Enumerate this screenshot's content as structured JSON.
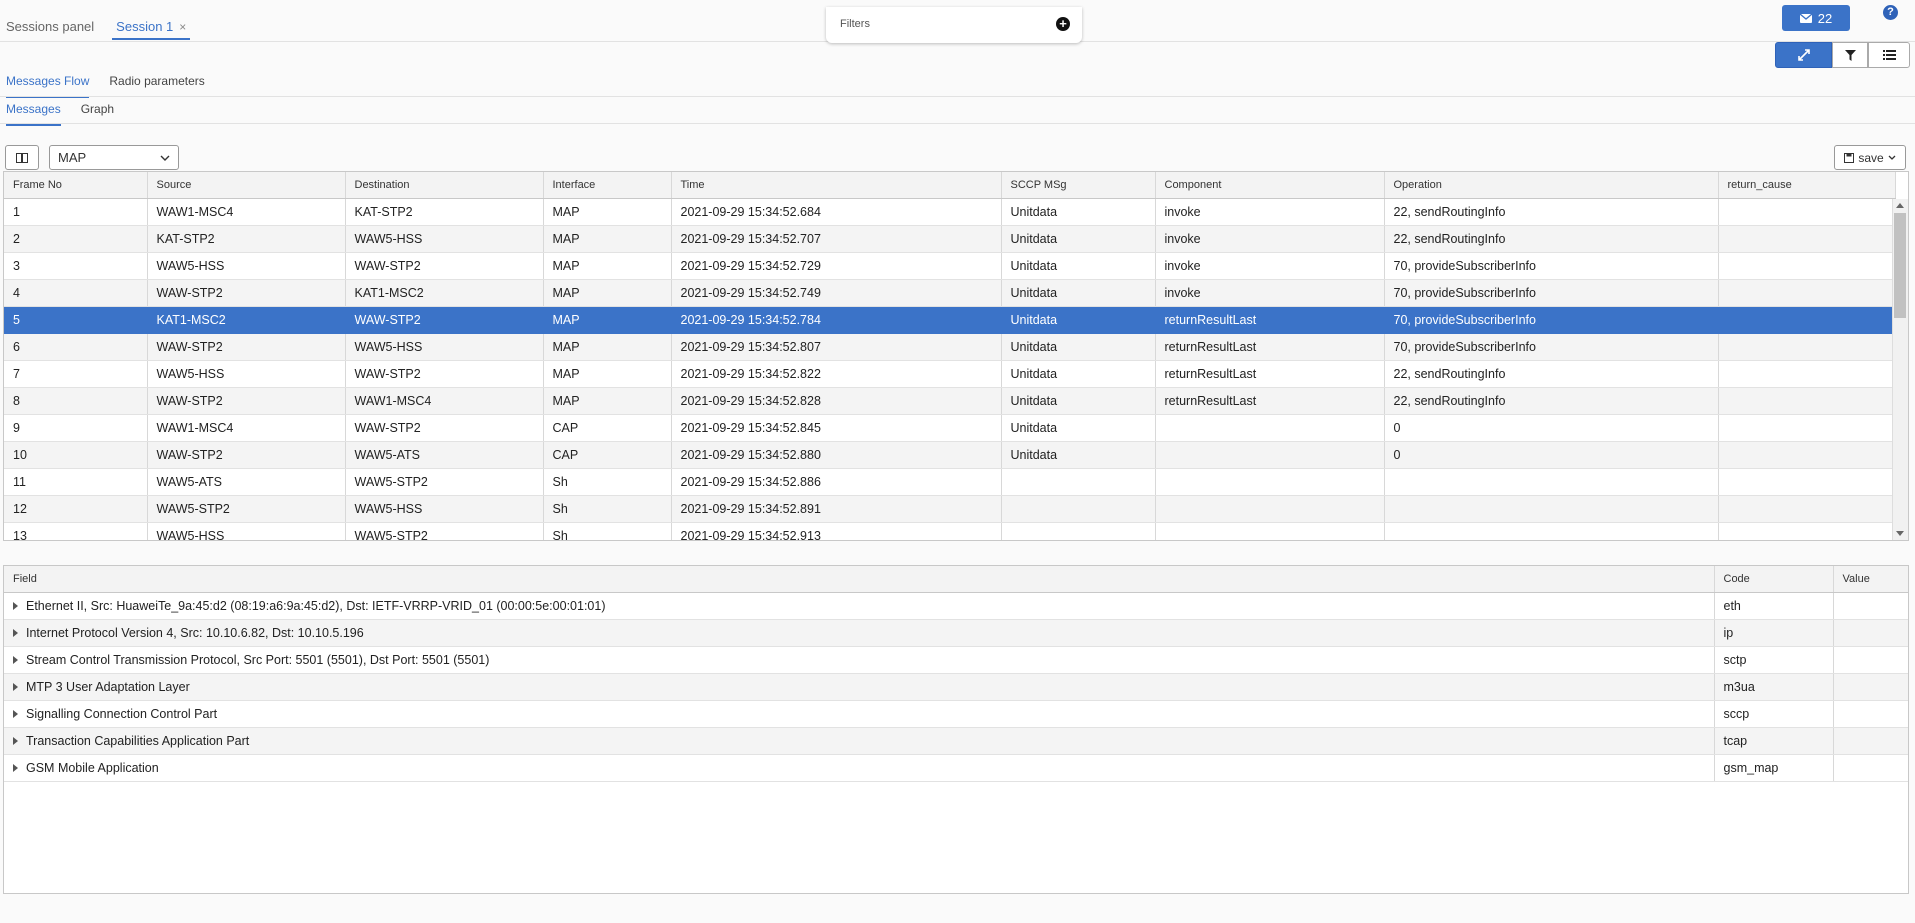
{
  "top_tabs": [
    {
      "label": "Sessions panel"
    },
    {
      "label": "Session 1",
      "close": "×"
    }
  ],
  "filters": {
    "label": "Filters",
    "add": "+"
  },
  "mail": {
    "count": "22"
  },
  "help": {
    "label": "?"
  },
  "tabs": {
    "level1": [
      {
        "label": "Messages Flow"
      },
      {
        "label": "Radio parameters"
      }
    ],
    "level2": [
      {
        "label": "Messages"
      },
      {
        "label": "Graph"
      }
    ]
  },
  "protocol_select": {
    "value": "MAP"
  },
  "save": {
    "label": "save"
  },
  "messages_table": {
    "columns": [
      "Frame No",
      "Source",
      "Destination",
      "Interface",
      "Time",
      "SCCP MSg",
      "Component",
      "Operation",
      "return_cause"
    ],
    "selected_index": 4,
    "rows": [
      [
        "1",
        "WAW1-MSC4",
        "KAT-STP2",
        "MAP",
        "2021-09-29 15:34:52.684",
        "Unitdata",
        "invoke",
        "22, sendRoutingInfo",
        ""
      ],
      [
        "2",
        "KAT-STP2",
        "WAW5-HSS",
        "MAP",
        "2021-09-29 15:34:52.707",
        "Unitdata",
        "invoke",
        "22, sendRoutingInfo",
        ""
      ],
      [
        "3",
        "WAW5-HSS",
        "WAW-STP2",
        "MAP",
        "2021-09-29 15:34:52.729",
        "Unitdata",
        "invoke",
        "70, provideSubscriberInfo",
        ""
      ],
      [
        "4",
        "WAW-STP2",
        "KAT1-MSC2",
        "MAP",
        "2021-09-29 15:34:52.749",
        "Unitdata",
        "invoke",
        "70, provideSubscriberInfo",
        ""
      ],
      [
        "5",
        "KAT1-MSC2",
        "WAW-STP2",
        "MAP",
        "2021-09-29 15:34:52.784",
        "Unitdata",
        "returnResultLast",
        "70, provideSubscriberInfo",
        ""
      ],
      [
        "6",
        "WAW-STP2",
        "WAW5-HSS",
        "MAP",
        "2021-09-29 15:34:52.807",
        "Unitdata",
        "returnResultLast",
        "70, provideSubscriberInfo",
        ""
      ],
      [
        "7",
        "WAW5-HSS",
        "WAW-STP2",
        "MAP",
        "2021-09-29 15:34:52.822",
        "Unitdata",
        "returnResultLast",
        "22, sendRoutingInfo",
        ""
      ],
      [
        "8",
        "WAW-STP2",
        "WAW1-MSC4",
        "MAP",
        "2021-09-29 15:34:52.828",
        "Unitdata",
        "returnResultLast",
        "22, sendRoutingInfo",
        ""
      ],
      [
        "9",
        "WAW1-MSC4",
        "WAW-STP2",
        "CAP",
        "2021-09-29 15:34:52.845",
        "Unitdata",
        "",
        "0",
        ""
      ],
      [
        "10",
        "WAW-STP2",
        "WAW5-ATS",
        "CAP",
        "2021-09-29 15:34:52.880",
        "Unitdata",
        "",
        "0",
        ""
      ],
      [
        "11",
        "WAW5-ATS",
        "WAW5-STP2",
        "Sh",
        "2021-09-29 15:34:52.886",
        "",
        "",
        "",
        ""
      ],
      [
        "12",
        "WAW5-STP2",
        "WAW5-HSS",
        "Sh",
        "2021-09-29 15:34:52.891",
        "",
        "",
        "",
        ""
      ],
      [
        "13",
        "WAW5-HSS",
        "WAW5-STP2",
        "Sh",
        "2021-09-29 15:34:52.913",
        "",
        "",
        "",
        ""
      ]
    ]
  },
  "details_table": {
    "columns": [
      "Field",
      "Code",
      "Value"
    ],
    "rows": [
      [
        "Ethernet II, Src: HuaweiTe_9a:45:d2 (08:19:a6:9a:45:d2), Dst: IETF-VRRP-VRID_01 (00:00:5e:00:01:01)",
        "eth",
        ""
      ],
      [
        "Internet Protocol Version 4, Src: 10.10.6.82, Dst: 10.10.5.196",
        "ip",
        ""
      ],
      [
        "Stream Control Transmission Protocol, Src Port: 5501 (5501), Dst Port: 5501 (5501)",
        "sctp",
        ""
      ],
      [
        "MTP 3 User Adaptation Layer",
        "m3ua",
        ""
      ],
      [
        "Signalling Connection Control Part",
        "sccp",
        ""
      ],
      [
        "Transaction Capabilities Application Part",
        "tcap",
        ""
      ],
      [
        "GSM Mobile Application",
        "gsm_map",
        ""
      ]
    ]
  }
}
